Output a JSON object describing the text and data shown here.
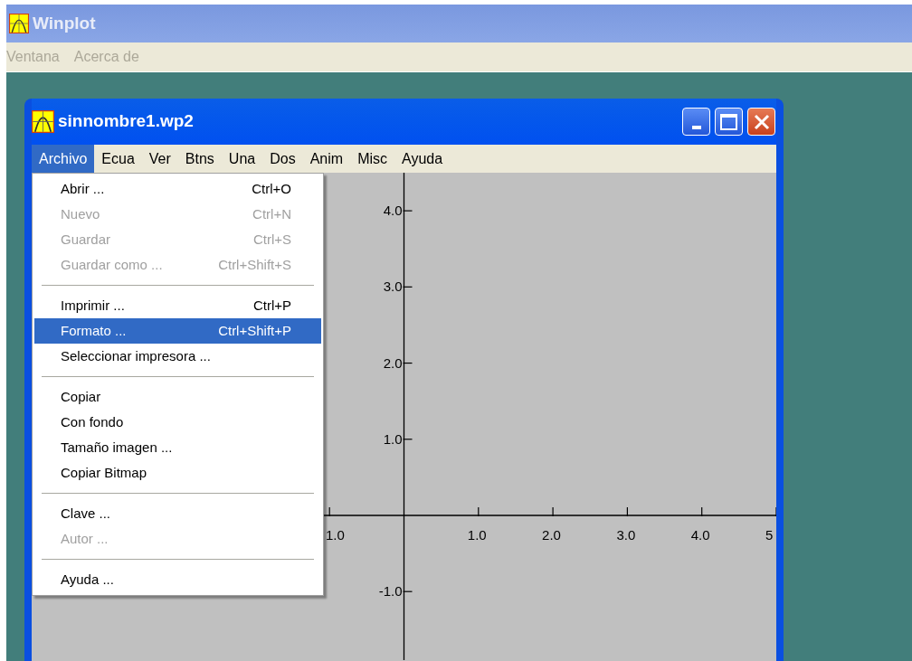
{
  "app_window": {
    "title": "Winplot",
    "menu": [
      {
        "label": "Ventana",
        "disabled": true
      },
      {
        "label": "Acerca de",
        "disabled": true
      }
    ]
  },
  "document_window": {
    "title": "sinnombre1.wp2",
    "menu": [
      {
        "label": "Archivo",
        "selected": true
      },
      {
        "label": "Ecua",
        "selected": false
      },
      {
        "label": "Ver",
        "selected": false
      },
      {
        "label": "Btns",
        "selected": false
      },
      {
        "label": "Una",
        "selected": false
      },
      {
        "label": "Dos",
        "selected": false
      },
      {
        "label": "Anim",
        "selected": false
      },
      {
        "label": "Misc",
        "selected": false
      },
      {
        "label": "Ayuda",
        "selected": false
      }
    ],
    "dropdown": [
      {
        "kind": "item",
        "label": "Abrir ...",
        "shortcut": "Ctrl+O",
        "disabled": false,
        "selected": false
      },
      {
        "kind": "item",
        "label": "Nuevo",
        "shortcut": "Ctrl+N",
        "disabled": true,
        "selected": false
      },
      {
        "kind": "item",
        "label": "Guardar",
        "shortcut": "Ctrl+S",
        "disabled": true,
        "selected": false
      },
      {
        "kind": "item",
        "label": "Guardar como ...",
        "shortcut": "Ctrl+Shift+S",
        "disabled": true,
        "selected": false
      },
      {
        "kind": "separator"
      },
      {
        "kind": "item",
        "label": "Imprimir ...",
        "shortcut": "Ctrl+P",
        "disabled": false,
        "selected": false
      },
      {
        "kind": "item",
        "label": "Formato ...",
        "shortcut": "Ctrl+Shift+P",
        "disabled": false,
        "selected": true
      },
      {
        "kind": "item",
        "label": "Seleccionar impresora ...",
        "disabled": false,
        "selected": false
      },
      {
        "kind": "separator"
      },
      {
        "kind": "item",
        "label": "Copiar",
        "disabled": false,
        "selected": false
      },
      {
        "kind": "item",
        "label": "Con fondo",
        "disabled": false,
        "selected": false
      },
      {
        "kind": "item",
        "label": "Tamaño imagen ...",
        "disabled": false,
        "selected": false
      },
      {
        "kind": "item",
        "label": "Copiar Bitmap",
        "disabled": false,
        "selected": false
      },
      {
        "kind": "separator"
      },
      {
        "kind": "item",
        "label": "Clave ...",
        "disabled": false,
        "selected": false
      },
      {
        "kind": "item",
        "label": "Autor ...",
        "disabled": true,
        "selected": false
      },
      {
        "kind": "separator"
      },
      {
        "kind": "item",
        "label": "Ayuda ...",
        "disabled": false,
        "selected": false
      }
    ],
    "plot": {
      "chart_data": {
        "type": "line",
        "xlim": [
          -5,
          5
        ],
        "ylim": [
          -1.9,
          4.5
        ],
        "xticks": [
          {
            "value": -1,
            "label": "1.0"
          },
          {
            "value": 1,
            "label": "1.0"
          },
          {
            "value": 2,
            "label": "2.0"
          },
          {
            "value": 3,
            "label": "3.0"
          },
          {
            "value": 4,
            "label": "4.0"
          },
          {
            "value": 5,
            "label": "5"
          }
        ],
        "yticks": [
          {
            "value": 4,
            "label": "4.0"
          },
          {
            "value": 3,
            "label": "3.0"
          },
          {
            "value": 2,
            "label": "2.0"
          },
          {
            "value": 1,
            "label": "1.0"
          },
          {
            "value": -1,
            "label": "-1.0"
          }
        ]
      }
    }
  }
}
